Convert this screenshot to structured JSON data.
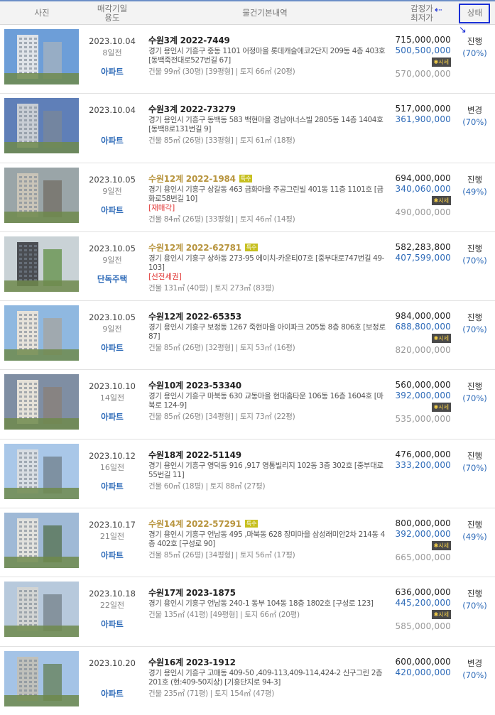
{
  "header": {
    "photo": "사진",
    "date_line1": "매각기일",
    "date_line2": "용도",
    "info": "물건기본내역",
    "price_line1": "감정가",
    "price_line2": "최저가",
    "status": "상태"
  },
  "badges": {
    "special": "특수",
    "market": "✱시세"
  },
  "rows": [
    {
      "date": "2023.10.04",
      "ago": "8일전",
      "type": "아파트",
      "case": "수원3계 2022-7449",
      "special": false,
      "addr": "경기 용인시 기흥구 중동 1101 어정마을 롯데캐슬에코2단지 209동 4층 403호 [동백죽전대로527번길 67]",
      "tag": "",
      "spec": "건물 99㎡ (30평) [39평형]  |  토지 66㎡ (20평)",
      "appraisal": "715,000,000",
      "minimum": "500,500,000",
      "market": "570,000,000",
      "status": "진행",
      "pct": "(70%)"
    },
    {
      "date": "2023.10.04",
      "ago": "",
      "type": "아파트",
      "case": "수원3계 2022-73279",
      "special": false,
      "addr": "경기 용인시 기흥구 동백동 583 백현마을 경남아너스빌 2805동 14층 1404호 [동백8로131번길 9]",
      "tag": "",
      "spec": "건물 85㎡ (26평) [33평형]  |  토지 61㎡ (18평)",
      "appraisal": "517,000,000",
      "minimum": "361,900,000",
      "market": "",
      "status": "변경",
      "pct": "(70%)"
    },
    {
      "date": "2023.10.05",
      "ago": "9일전",
      "type": "아파트",
      "case": "수원12계 2022-1984",
      "special": true,
      "addr": "경기 용인시 기흥구 상갈동 463 금화마을 주공그린빌 401동 11층 1101호 [금화로58번길 10]",
      "tag": "[재매각]",
      "spec": "건물 84㎡ (26평) [33평형]  |  토지 46㎡ (14평)",
      "appraisal": "694,000,000",
      "minimum": "340,060,000",
      "market": "490,000,000",
      "status": "진행",
      "pct": "(49%)"
    },
    {
      "date": "2023.10.05",
      "ago": "9일전",
      "type": "단독주택",
      "case": "수원12계 2022-62781",
      "special": true,
      "addr": "경기 용인시 기흥구 상하동 273-95 에이치-카운티07호 [중부대로747번길 49-103]",
      "tag": "[선전세권]",
      "spec": "건물 131㎡ (40평)  |  토지 273㎡ (83평)",
      "appraisal": "582,283,800",
      "minimum": "407,599,000",
      "market": "",
      "status": "진행",
      "pct": "(70%)"
    },
    {
      "date": "2023.10.05",
      "ago": "9일전",
      "type": "아파트",
      "case": "수원12계 2022-65353",
      "special": false,
      "addr": "경기 용인시 기흥구 보정동 1267 죽현마을 아이파크 205동 8층 806호 [보정로 87]",
      "tag": "",
      "spec": "건물 85㎡ (26평) [32평형]  |  토지 53㎡ (16평)",
      "appraisal": "984,000,000",
      "minimum": "688,800,000",
      "market": "820,000,000",
      "status": "진행",
      "pct": "(70%)"
    },
    {
      "date": "2023.10.10",
      "ago": "14일전",
      "type": "아파트",
      "case": "수원10계 2023-53340",
      "special": false,
      "addr": "경기 용인시 기흥구 마북동 630 교동마을 현대홈타운 106동 16층 1604호 [마북로 124-9]",
      "tag": "",
      "spec": "건물 85㎡ (26평) [34평형]  |  토지 73㎡ (22평)",
      "appraisal": "560,000,000",
      "minimum": "392,000,000",
      "market": "535,000,000",
      "status": "진행",
      "pct": "(70%)"
    },
    {
      "date": "2023.10.12",
      "ago": "16일전",
      "type": "아파트",
      "case": "수원18계 2022-51149",
      "special": false,
      "addr": "경기 용인시 기흥구 영덕동 916 ,917 영통빌리지 102동 3층 302호 [중부대로55번길 11]",
      "tag": "",
      "spec": "건물 60㎡ (18평)  |  토지 88㎡ (27평)",
      "appraisal": "476,000,000",
      "minimum": "333,200,000",
      "market": "",
      "status": "진행",
      "pct": "(70%)"
    },
    {
      "date": "2023.10.17",
      "ago": "21일전",
      "type": "아파트",
      "case": "수원14계 2022-57291",
      "special": true,
      "addr": "경기 용인시 기흥구 언남동 495 ,마북동 628 장미마을 삼성래미안2차 214동 4층 402호 [구성로 90]",
      "tag": "",
      "spec": "건물 85㎡ (26평) [34평형]  |  토지 56㎡ (17평)",
      "appraisal": "800,000,000",
      "minimum": "392,000,000",
      "market": "665,000,000",
      "status": "진행",
      "pct": "(49%)"
    },
    {
      "date": "2023.10.18",
      "ago": "22일전",
      "type": "아파트",
      "case": "수원17계 2023-1875",
      "special": false,
      "addr": "경기 용인시 기흥구 언남동 240-1 동부 104동 18층 1802호 [구성로 123]",
      "tag": "",
      "spec": "건물 135㎡ (41평) [49평형]  |  토지 66㎡ (20평)",
      "appraisal": "636,000,000",
      "minimum": "445,200,000",
      "market": "585,000,000",
      "status": "진행",
      "pct": "(70%)"
    },
    {
      "date": "2023.10.20",
      "ago": "",
      "type": "아파트",
      "case": "수원16계 2023-1912",
      "special": false,
      "addr": "경기 용인시 기흥구 고매동 409-50 ,409-113,409-114,424-2 신구그린 2층 201호 (현:409-50지상) [기흥단지로 94-3]",
      "tag": "",
      "spec": "건물 235㎡ (71평)  |  토지 154㎡ (47평)",
      "appraisal": "600,000,000",
      "minimum": "420,000,000",
      "market": "",
      "status": "변경",
      "pct": "(70%)"
    }
  ]
}
